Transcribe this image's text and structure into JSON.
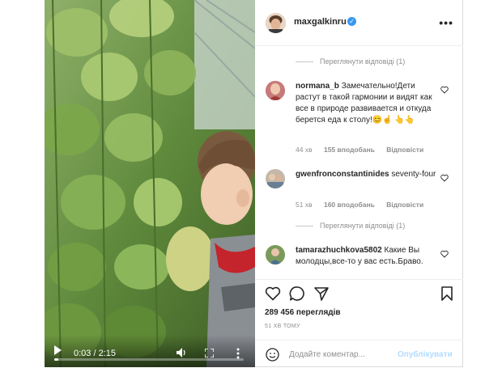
{
  "video": {
    "time_display": "0:03 / 2:15",
    "progress_fraction": 0.023
  },
  "header": {
    "username": "maxgalkinru",
    "verified_mark": "✓",
    "more_label": "•••"
  },
  "comments": {
    "view_replies_1": "Переглянути відповіді (1)",
    "items": [
      {
        "username": "normana_b",
        "text": "Замечательно!Дети растут в такой гармонии и видят как все в природе развивается и откуда берется еда к столу!😊☝ 👆👆",
        "time": "44 хв",
        "likes": "155 вподобань",
        "reply": "Відповісти"
      },
      {
        "username": "gwenfronconstantinides",
        "text": "seventy-four",
        "time": "51 хв",
        "likes": "160 вподобань",
        "reply": "Відповісти"
      },
      {
        "username": "tamarazhuchkova5802",
        "text": "Какие Вы молодцы,все-то у вас есть.Браво."
      }
    ],
    "view_replies_2": "Переглянути відповіді (1)"
  },
  "actions": {
    "views": "289 456 переглядів",
    "time_ago": "51 ХВ ТОМУ"
  },
  "add_comment": {
    "placeholder": "Додайте коментар...",
    "post_label": "Опублікувати"
  },
  "icons": {
    "emoji": "emoji-icon",
    "like": "heart-icon",
    "comment": "comment-icon",
    "share": "paper-plane-icon",
    "save": "bookmark-icon"
  },
  "colors": {
    "link_disabled": "#b3dbff",
    "verified": "#3897f0",
    "muted": "#8e8e8e"
  }
}
